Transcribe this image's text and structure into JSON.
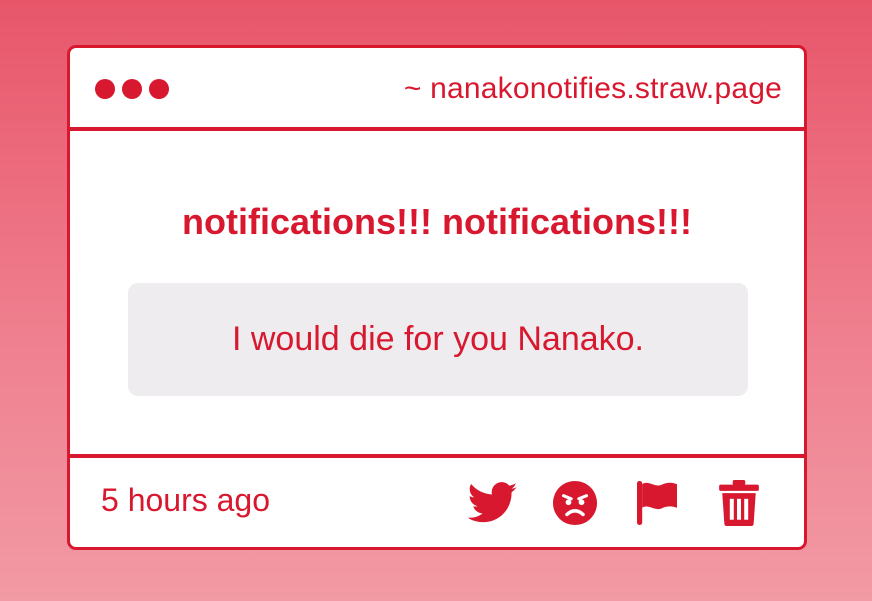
{
  "window": {
    "url": "~ nanakonotifies.straw.page"
  },
  "notification": {
    "heading": "notifications!!! notifications!!!",
    "message": "I would die for you Nanako.",
    "time": "5 hours ago"
  },
  "actions": [
    {
      "icon": "twitter-icon"
    },
    {
      "icon": "angry-face-icon"
    },
    {
      "icon": "flag-icon"
    },
    {
      "icon": "trash-icon"
    }
  ],
  "colors": {
    "accent": "#d8182f",
    "background_top": "#e8566a",
    "background_bottom": "#f29aa5",
    "message_box": "#eeecee",
    "card": "#ffffff"
  }
}
